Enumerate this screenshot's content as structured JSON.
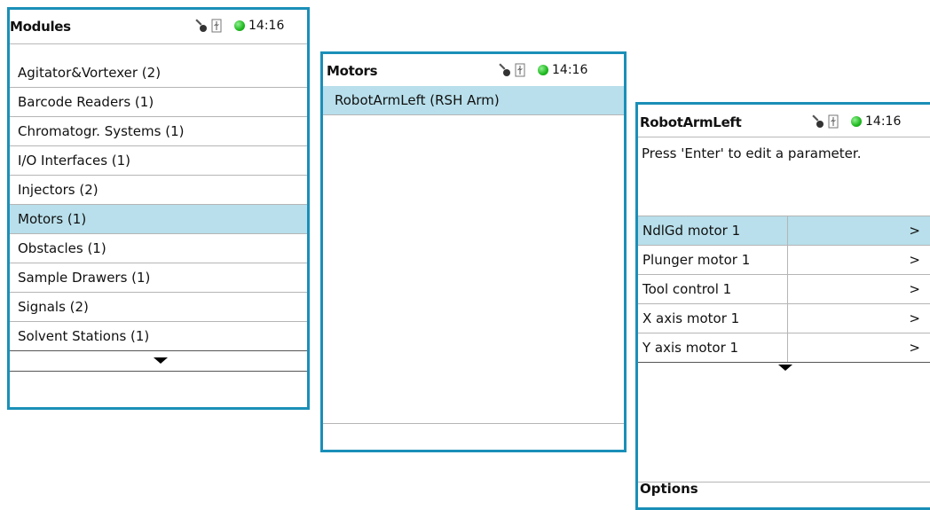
{
  "modules_panel": {
    "title": "Modules",
    "time": "14:16",
    "items": [
      {
        "label": "Agitator&Vortexer (2)"
      },
      {
        "label": "Barcode Readers (1)"
      },
      {
        "label": "Chromatogr. Systems (1)"
      },
      {
        "label": "I/O Interfaces (1)"
      },
      {
        "label": "Injectors (2)"
      },
      {
        "label": "Motors (1)",
        "selected": true
      },
      {
        "label": "Obstacles (1)"
      },
      {
        "label": "Sample Drawers (1)"
      },
      {
        "label": "Signals (2)"
      },
      {
        "label": "Solvent Stations (1)"
      }
    ]
  },
  "motors_panel": {
    "title": "Motors",
    "time": "14:16",
    "items": [
      {
        "label": "RobotArmLeft (RSH Arm)",
        "selected": true
      }
    ]
  },
  "robotarm_panel": {
    "title": "RobotArmLeft",
    "time": "14:16",
    "hint": "Press 'Enter' to edit a parameter.",
    "params": [
      {
        "name": "NdlGd motor 1",
        "value": ">",
        "selected": true
      },
      {
        "name": "Plunger motor 1",
        "value": ">"
      },
      {
        "name": "Tool control 1",
        "value": ">"
      },
      {
        "name": "X axis motor 1",
        "value": ">"
      },
      {
        "name": "Y axis motor 1",
        "value": ">"
      }
    ],
    "options_label": "Options"
  },
  "status_icons": {
    "key": "key-icon",
    "usb": "usb-icon",
    "connection": "green-status-dot"
  },
  "colors": {
    "border": "#1a8fb8",
    "selected_row": "#b8dfeb",
    "status_dot": "#1eb81e"
  }
}
